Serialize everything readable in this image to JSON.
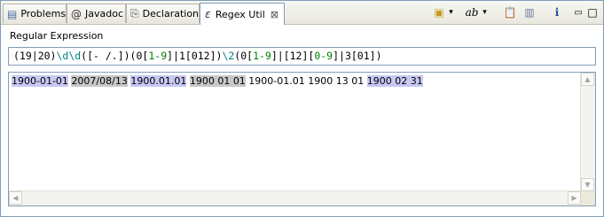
{
  "tabs": [
    {
      "label": "Problems",
      "icon": "problems-icon",
      "glyph": "▤"
    },
    {
      "label": "Javadoc",
      "icon": "at-icon",
      "glyph": "@"
    },
    {
      "label": "Declaration",
      "icon": "declaration-icon",
      "glyph": "⎘"
    },
    {
      "label": "Regex Util",
      "icon": "epsilon-icon",
      "glyph": "ε",
      "active": true,
      "close": "⊠"
    }
  ],
  "toolbar": {
    "new_glyph": "▣",
    "new_menu": "▾",
    "ab_label": "ab",
    "ab_menu": "▾",
    "copy_glyph": "📋",
    "paste_glyph": "▥",
    "info_glyph": "i",
    "minimize_glyph": "▭",
    "maximize_glyph": "□"
  },
  "regex": {
    "label": "Regular Expression",
    "parts": [
      {
        "text": "(19|20)",
        "color": "#000000"
      },
      {
        "text": "\\d\\d",
        "color": "#008080"
      },
      {
        "text": "([- /.])(0[",
        "color": "#000000"
      },
      {
        "text": "1-9",
        "color": "#008000"
      },
      {
        "text": "]|1[012])",
        "color": "#000000"
      },
      {
        "text": "\\2",
        "color": "#008080"
      },
      {
        "text": "(0[",
        "color": "#000000"
      },
      {
        "text": "1-9",
        "color": "#008000"
      },
      {
        "text": "]|[12][",
        "color": "#000000"
      },
      {
        "text": "0-9",
        "color": "#008000"
      },
      {
        "text": "]|3[01])",
        "color": "#000000"
      }
    ]
  },
  "test_text": {
    "segments": [
      {
        "text": "1900-01-01",
        "highlight": "#c8c8f4"
      },
      {
        "text": " ",
        "highlight": ""
      },
      {
        "text": "2007/08/13",
        "highlight": "#c8c8c8"
      },
      {
        "text": " ",
        "highlight": ""
      },
      {
        "text": "1900.01.01",
        "highlight": "#c8c8f4"
      },
      {
        "text": " ",
        "highlight": ""
      },
      {
        "text": "1900 01 01",
        "highlight": "#c8c8c8"
      },
      {
        "text": " 1900-01.01 1900 13 01 ",
        "highlight": ""
      },
      {
        "text": "1900 02 31",
        "highlight": "#c8c8f4"
      }
    ]
  },
  "scrollbar": {
    "up": "▲",
    "down": "▼",
    "left": "◀",
    "right": "▶"
  }
}
